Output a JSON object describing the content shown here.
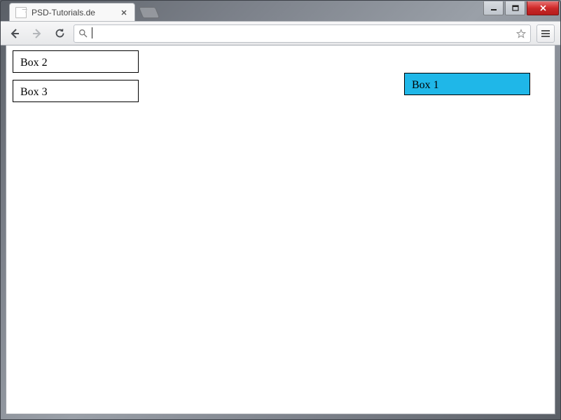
{
  "window": {
    "minimize_symbol": "",
    "maximize_symbol": "",
    "close_symbol": ""
  },
  "tab": {
    "title": "PSD-Tutorials.de"
  },
  "toolbar": {
    "url_value": ""
  },
  "page": {
    "box1_label": "Box 1",
    "box2_label": "Box 2",
    "box3_label": "Box 3"
  }
}
